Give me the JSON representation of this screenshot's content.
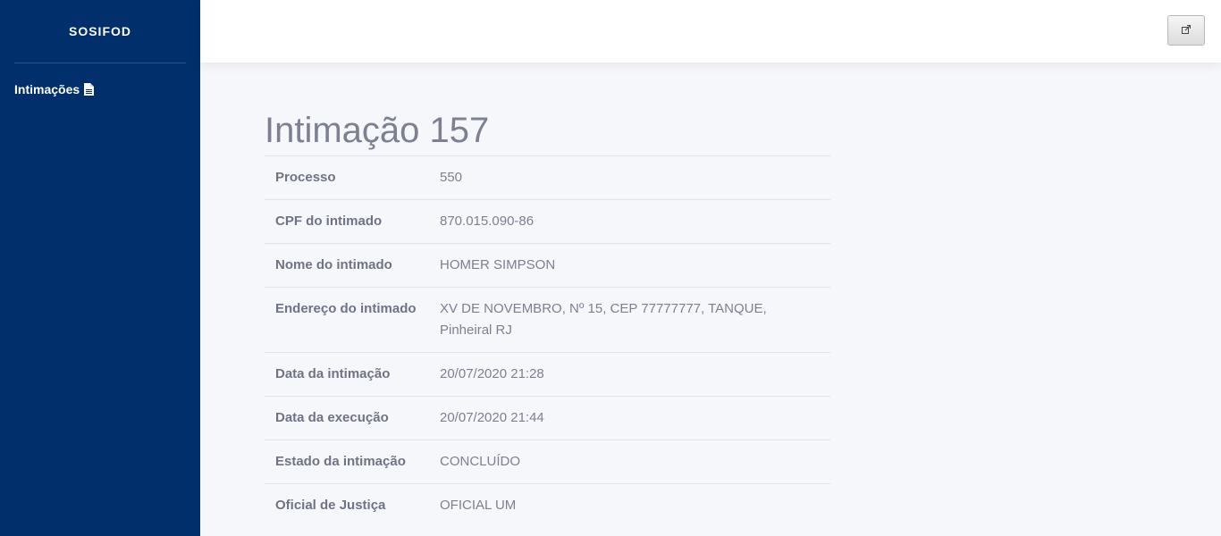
{
  "sidebar": {
    "brand": "SOSIFOD",
    "items": [
      {
        "label": "Intimações",
        "icon": "document-icon"
      }
    ]
  },
  "topbar": {
    "button_icon": "external-link-icon"
  },
  "main": {
    "title": "Intimação 157",
    "rows": [
      {
        "label": "Processo",
        "value": "550"
      },
      {
        "label": "CPF do intimado",
        "value": "870.015.090-86"
      },
      {
        "label": "Nome do intimado",
        "value": "HOMER SIMPSON"
      },
      {
        "label": "Endereço do intimado",
        "value": "XV DE NOVEMBRO, Nº 15, CEP 77777777, TANQUE, Pinheiral RJ"
      },
      {
        "label": "Data da intimação",
        "value": "20/07/2020 21:28"
      },
      {
        "label": "Data da execução",
        "value": "20/07/2020 21:44"
      },
      {
        "label": "Estado da intimação",
        "value": "CONCLUÍDO"
      },
      {
        "label": "Oficial de Justiça",
        "value": "OFICIAL UM"
      }
    ]
  },
  "colors": {
    "sidebar": "#002f6c",
    "background": "#f6f7fb",
    "text": "#7d8091"
  }
}
